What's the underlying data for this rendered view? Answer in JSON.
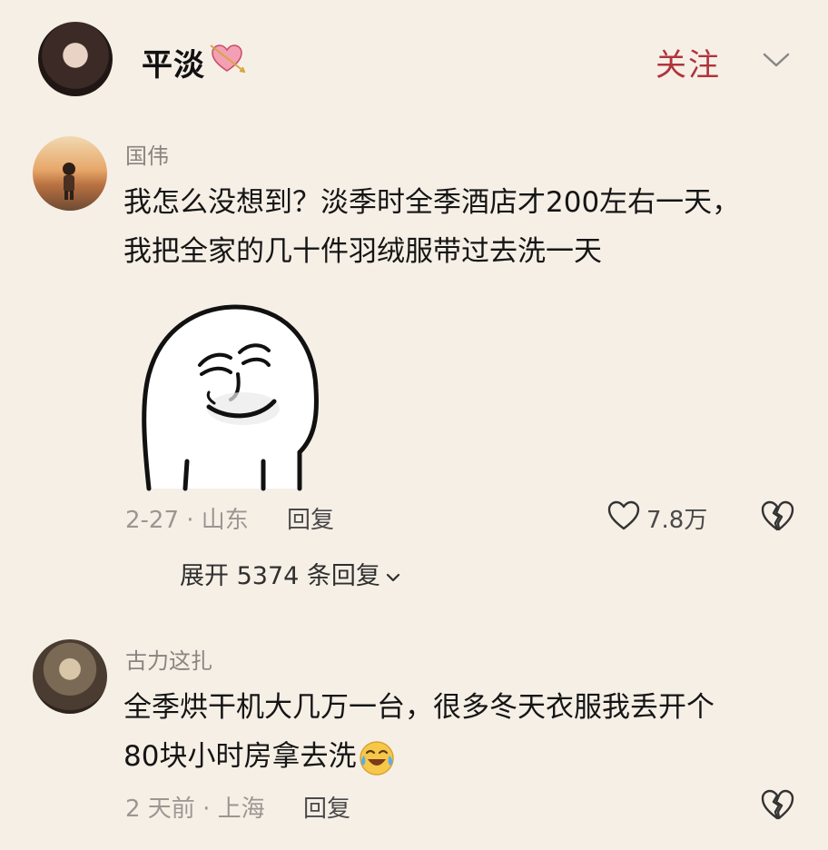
{
  "header": {
    "author_name": "平淡",
    "follow_label": "关注",
    "name_decoration_icon": "heart-arrow-icon",
    "menu_icon": "chevron-down-icon"
  },
  "comments": [
    {
      "username": "国伟",
      "text_line1": "我怎么没想到？淡季时全季酒店才200左右一天，",
      "text_line2": "我把全家的几十件羽绒服带过去洗一天",
      "sticker": "smirking-face-sticker",
      "meta": "2-27 · 山东",
      "reply_label": "回复",
      "like_count": "7.8万",
      "expand_replies_label": "展开 5374 条回复"
    },
    {
      "username": "古力这扎",
      "text_line1": "全季烘干机大几万一台，很多冬天衣服我丢开个",
      "text_line2": "80块小时房拿去洗",
      "emoji": "crying-laughing-emoji",
      "meta": "2 天前 · 上海",
      "reply_label": "回复"
    }
  ],
  "colors": {
    "background": "#f6efe6",
    "follow": "#b0343c",
    "meta_text": "#9a9692"
  }
}
